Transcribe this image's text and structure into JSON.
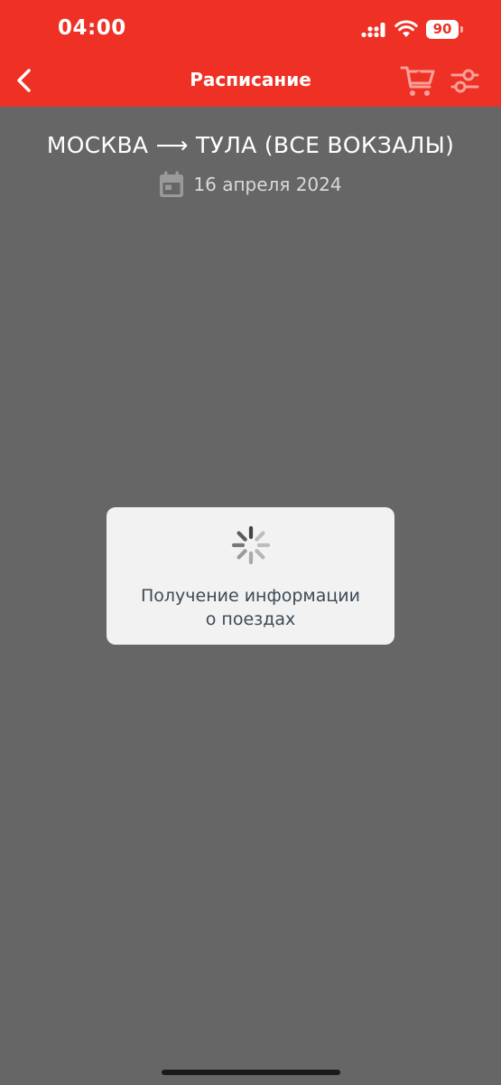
{
  "status_bar": {
    "time": "04:00",
    "battery": "90",
    "icons": [
      "signal-icon",
      "wifi-icon",
      "battery-icon"
    ]
  },
  "nav": {
    "title": "Расписание",
    "cart_count": "0",
    "icons": {
      "back": "chevron-left-icon",
      "cart": "cart-icon",
      "filter": "sliders-icon"
    }
  },
  "route": {
    "title": "МОСКВА ⟶ ТУЛА (ВСЕ ВОКЗАЛЫ)",
    "date": "16 апреля 2024",
    "date_icon": "calendar-icon"
  },
  "loading": {
    "line1": "Получение информации",
    "line2": "о поездах",
    "icon": "spinner-icon"
  },
  "colors": {
    "brand_red": "#ee3124",
    "overlay_gray": "#666666",
    "dialog_bg": "#f2f2f2",
    "dialog_text": "#3d4a55"
  }
}
